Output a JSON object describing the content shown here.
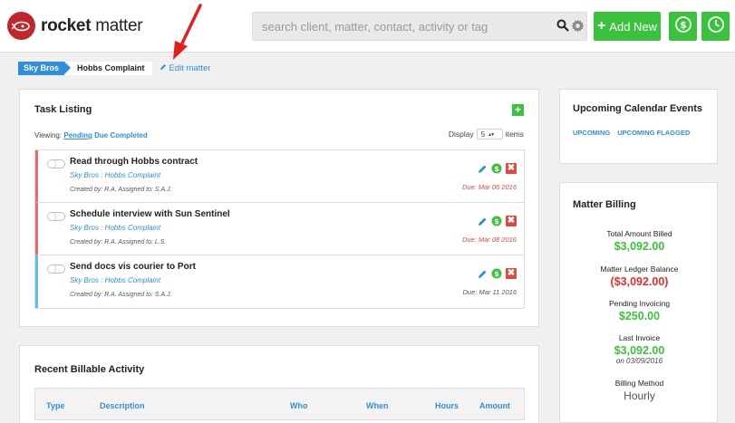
{
  "header": {
    "logo_bold": "rocket",
    "logo_regular": " matter",
    "search_placeholder": "search client, matter, contact, activity or tag",
    "add_new_label": "Add New",
    "icons": [
      "search-icon",
      "gear-icon",
      "dollar-icon",
      "clock-icon"
    ],
    "accent_color": "#3ac23c",
    "brand_color": "#c0272d"
  },
  "breadcrumb": {
    "client": "Sky Bros",
    "matter": "Hobbs Complaint",
    "edit_label": "Edit matter"
  },
  "task_listing": {
    "title": "Task Listing",
    "viewing_label": "Viewing:",
    "filters": [
      "Pending",
      "Due",
      "Completed"
    ],
    "display_label": "Display",
    "display_value": "5",
    "items_label": "items",
    "tasks": [
      {
        "title": "Read through Hobbs contract",
        "matter": "Sky Bros : Hobbs Complaint",
        "meta": "Created by: R.A. Assigned to: S.A.J.",
        "due": "Due: Mar 06 2016",
        "overdue": true
      },
      {
        "title": "Schedule interview with Sun Sentinel",
        "matter": "Sky Bros : Hobbs Complaint",
        "meta": "Created by: R.A. Assigned to: L.S.",
        "due": "Due: Mar 08 2016",
        "overdue": true
      },
      {
        "title": "Send docs vis courier to Port",
        "matter": "Sky Bros : Hobbs Complaint",
        "meta": "Created by: R.A. Assigned to: S.A.J.",
        "due": "Due: Mar 11 2016",
        "overdue": false
      }
    ]
  },
  "billable_activity": {
    "title": "Recent Billable Activity",
    "columns": [
      "Type",
      "Description",
      "Who",
      "When",
      "Hours",
      "Amount"
    ]
  },
  "calendar": {
    "title": "Upcoming Calendar Events",
    "links": [
      "UPCOMING",
      "UPCOMING FLAGGED"
    ]
  },
  "billing": {
    "title": "Matter Billing",
    "total_label": "Total Amount Billed",
    "total_value": "$3,092.00",
    "ledger_label": "Matter Ledger Balance",
    "ledger_value": "($3,092.00)",
    "pending_label": "Pending Invoicing",
    "pending_value": "$250.00",
    "last_invoice_label": "Last Invoice",
    "last_invoice_value": "$3,092.00",
    "last_invoice_date": "on 03/09/2016",
    "method_label": "Billing Method",
    "method_value": "Hourly"
  }
}
